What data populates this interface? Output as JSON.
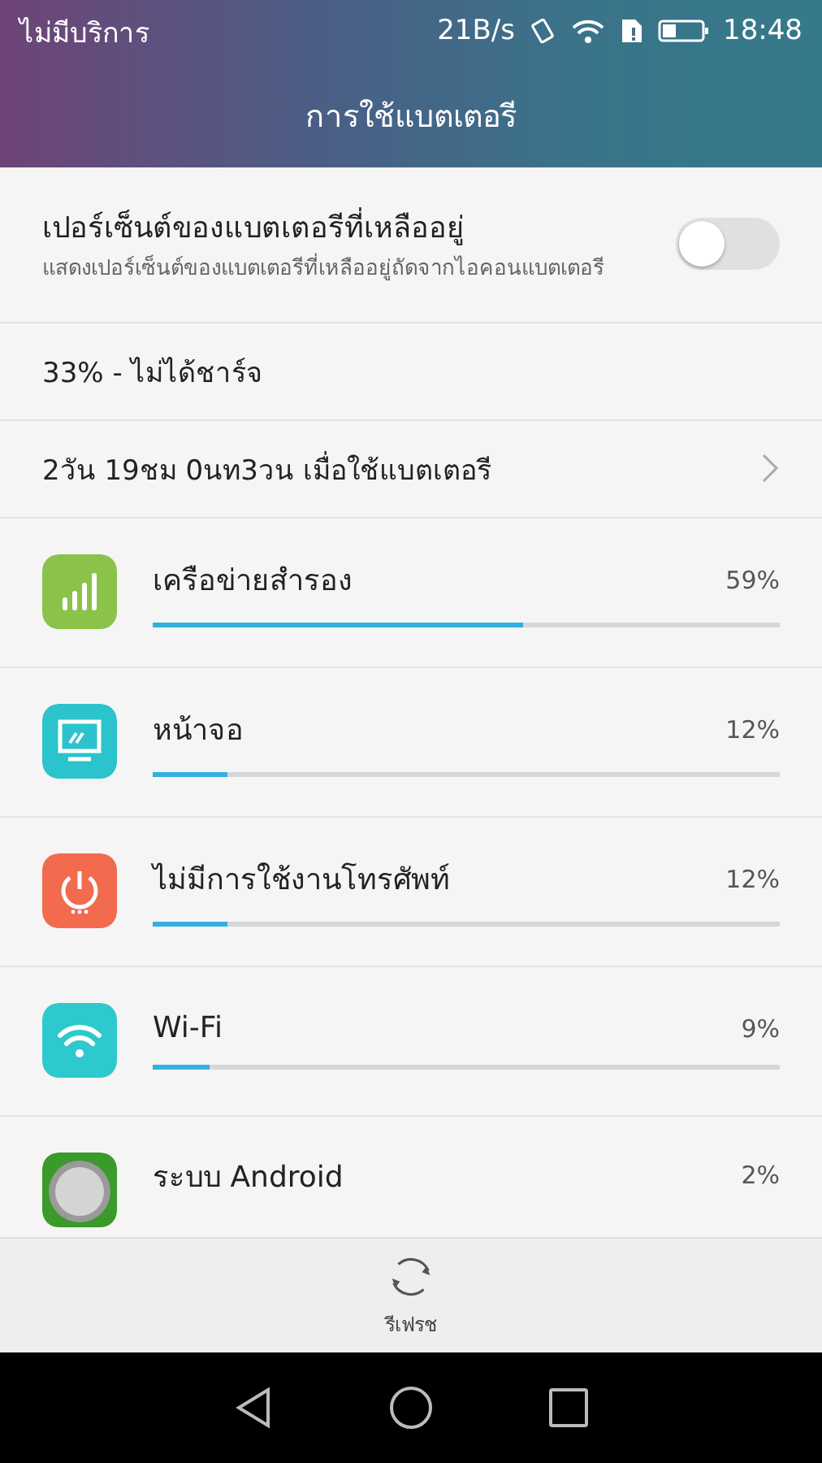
{
  "status_bar": {
    "carrier": "ไม่มีบริการ",
    "speed": "21B/s",
    "time": "18:48"
  },
  "title": "การใช้แบตเตอรี",
  "toggle_row": {
    "title": "เปอร์เซ็นต์ของแบตเตอรีที่เหลืออยู่",
    "description": "แสดงเปอร์เซ็นต์ของแบตเตอรีที่เหลืออยู่ถัดจากไอคอนแบตเตอรี",
    "on": false
  },
  "battery_status": "33% - ไม่ได้ชาร์จ",
  "time_remaining": "2วัน 19ชม 0นท3วน เมื่อใช้แบตเตอรี",
  "usage": [
    {
      "kind": "signal",
      "name": "เครือข่ายสำรอง",
      "percent": "59%",
      "level": 0.59
    },
    {
      "kind": "screen",
      "name": "หน้าจอ",
      "percent": "12%",
      "level": 0.12
    },
    {
      "kind": "power",
      "name": "ไม่มีการใช้งานโทรศัพท์",
      "percent": "12%",
      "level": 0.12
    },
    {
      "kind": "wifi",
      "name": "Wi-Fi",
      "percent": "9%",
      "level": 0.09
    },
    {
      "kind": "android",
      "name": "ระบบ Android",
      "percent": "2%"
    }
  ],
  "bottom_action": {
    "label": "รีเฟรช"
  }
}
